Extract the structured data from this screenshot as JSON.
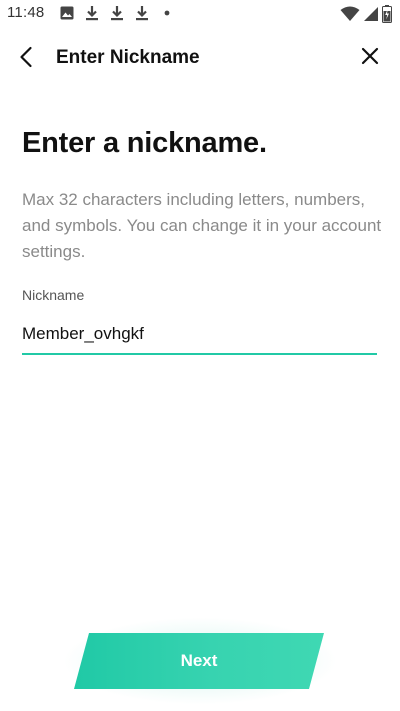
{
  "status_bar": {
    "time": "11:48",
    "left_icons": [
      "image-icon",
      "download-icon",
      "download-icon",
      "download-icon",
      "dot-icon"
    ],
    "right_icons": [
      "wifi-icon",
      "signal-icon",
      "battery-icon"
    ]
  },
  "app_bar": {
    "title": "Enter Nickname"
  },
  "main": {
    "heading": "Enter a nickname.",
    "description": "Max 32 characters including letters, numbers, and symbols. You can change it in your account settings.",
    "nickname_label": "Nickname",
    "nickname_value": "Member_ovhgkf"
  },
  "footer": {
    "next_label": "Next"
  },
  "colors": {
    "accent": "#21c9a6",
    "text_primary": "#111111",
    "text_secondary": "#8a8a8a",
    "background": "#ffffff"
  }
}
